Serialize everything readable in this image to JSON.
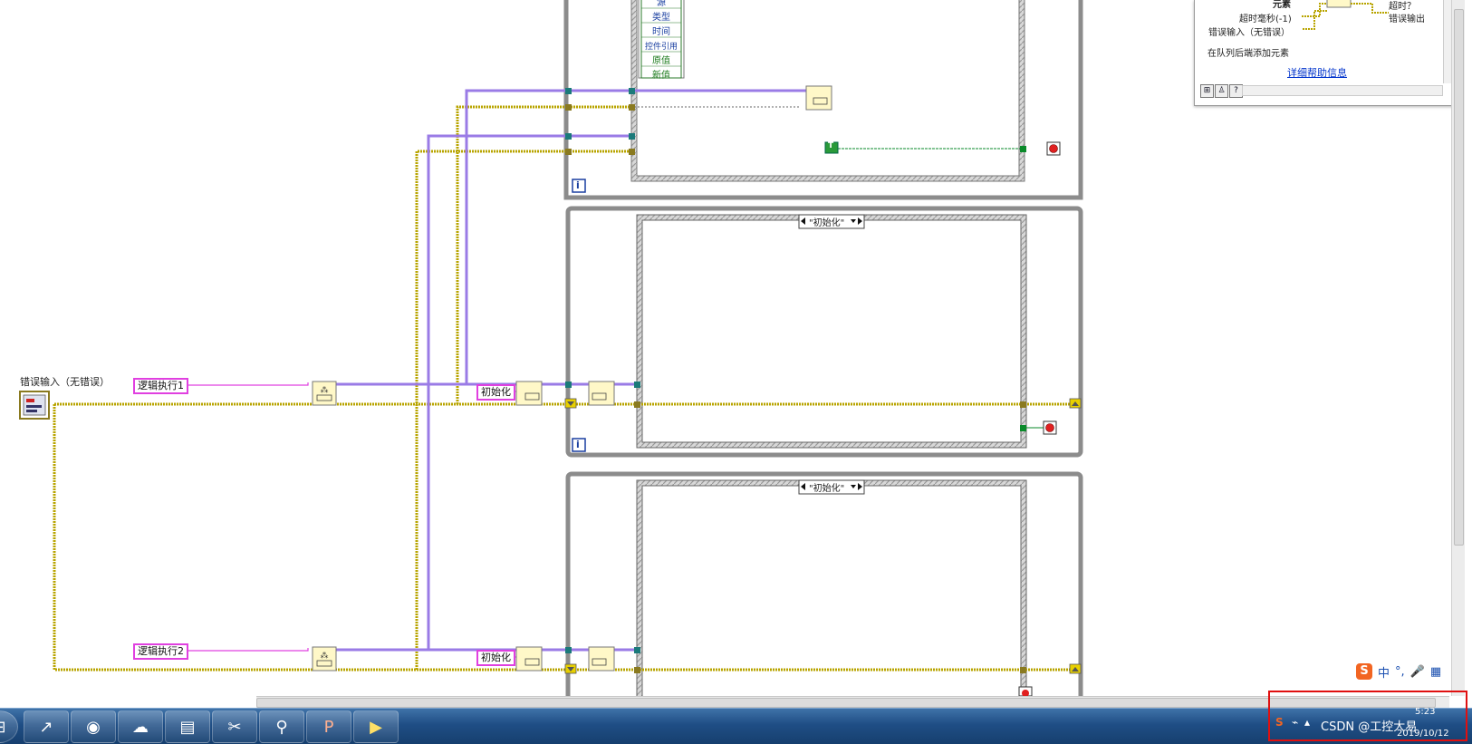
{
  "window": {
    "help": {
      "line_element": "元素",
      "line_timeout_out": "超时？",
      "line_timeout_ms": "超时毫秒(-1)",
      "line_error_out": "错误输出",
      "line_error_in": "错误输入（无错误）",
      "description": "在队列后端添加元素",
      "link": "详细帮助信息",
      "btn1": "⊞",
      "btn2": "♙",
      "btn3": "?"
    }
  },
  "diagram": {
    "error_in_label": "错误输入（无错误）",
    "logic1": "逻辑执行1",
    "logic2": "逻辑执行2",
    "init_const_1": "初始化",
    "init_const_2": "初始化",
    "case_selector_1": "\"初始化\"",
    "case_selector_2": "\"初始化\"",
    "cluster_fields": [
      "源",
      "类型",
      "时间",
      "控件引用",
      "原值",
      "新值"
    ],
    "loop_index": "i",
    "bool_true": "T"
  },
  "taskbar": {
    "apps": [
      "start-orb",
      "app-arrow",
      "browser",
      "baidu-pan",
      "file-explorer",
      "snipping-tool",
      "search-tool",
      "powerpoint",
      "labview"
    ],
    "ime_lang": "中",
    "ime_punct": "°,",
    "tray_text": "CSDN @工控大易",
    "clock_time": "5:23",
    "clock_date": "2019/10/12"
  },
  "colors": {
    "wire_error": "#b8a400",
    "wire_ref": "#9a7be6",
    "wire_string": "#e040e0",
    "wire_bool": "#0a8a2a",
    "struct_frame": "#888888",
    "taskbar": "#1f4e85",
    "highlight": "#e01010"
  }
}
